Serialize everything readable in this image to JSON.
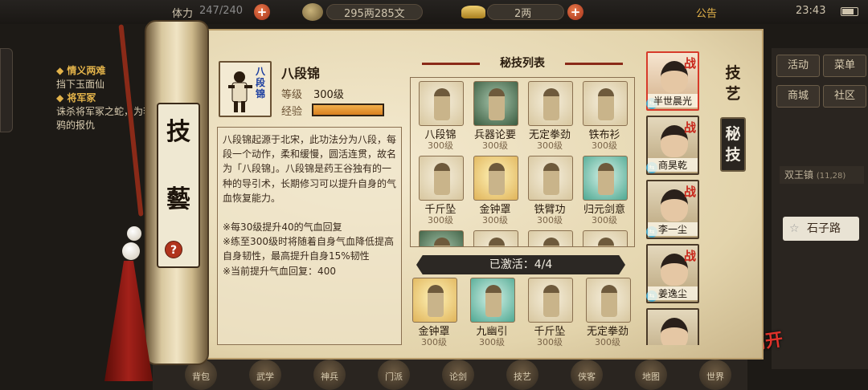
{
  "topbar": {
    "stamina_label": "体力",
    "stamina_value": "247/240",
    "money": "295两285文",
    "gold": "2两",
    "notice": "公告",
    "time": "23:43"
  },
  "quests": [
    {
      "title": "◆ 情义两难",
      "desc": "挡下玉面仙"
    },
    {
      "title": "◆ 将军冢",
      "desc": "诛杀将军冢之蛇，为李鸦的报仇"
    }
  ],
  "right_panel": {
    "buttons": [
      "活动",
      "菜单",
      "商城",
      "社区"
    ],
    "location": "双王镇",
    "location_coords": "(11,28)",
    "road": "石子路",
    "leave": "离开"
  },
  "dock": [
    "背包",
    "武学",
    "神兵",
    "门派",
    "论剑",
    "技艺",
    "侠客",
    "地图",
    "世界"
  ],
  "scroll": {
    "title_chars": [
      "技",
      "藝"
    ],
    "help": "?"
  },
  "skill": {
    "name": "八段锦",
    "portrait_text": "八段锦",
    "level_label": "等级",
    "level_value": "300级",
    "exp_label": "经验",
    "exp_fraction": 1.0,
    "description": "八段锦起源于北宋，此功法分为八段，每段一个动作，柔和缓慢，圆活连贯，故名为「八段锦」。八段锦是药王谷独有的一种的导引术，长期修习可以提升自身的气血恢复能力。",
    "notes": [
      "※每30级提升40的气血回复",
      "※练至300级时将随着自身气血降低提高自身韧性，最高提升自身15%韧性",
      "※当前提升气血回复：400"
    ]
  },
  "list": {
    "header": "秘技列表",
    "skills": [
      {
        "name": "八段锦",
        "level": "300级",
        "style": "plain"
      },
      {
        "name": "兵器论要",
        "level": "300级",
        "style": "book"
      },
      {
        "name": "无定拳劲",
        "level": "300级",
        "style": "plain"
      },
      {
        "name": "铁布衫",
        "level": "300级",
        "style": "plain"
      },
      {
        "name": "千斤坠",
        "level": "300级",
        "style": "plain"
      },
      {
        "name": "金钟罩",
        "level": "300级",
        "style": "gold"
      },
      {
        "name": "铁臂功",
        "level": "300级",
        "style": "plain"
      },
      {
        "name": "归元剑意",
        "level": "300级",
        "style": "teal"
      }
    ],
    "activated_label": "已激活：4/4",
    "activated": [
      {
        "name": "金钟罩",
        "level": "300级",
        "style": "gold"
      },
      {
        "name": "九幽引",
        "level": "300级",
        "style": "teal"
      },
      {
        "name": "千斤坠",
        "level": "300级",
        "style": "plain"
      },
      {
        "name": "无定拳劲",
        "level": "300级",
        "style": "plain"
      }
    ]
  },
  "heroes": [
    {
      "name": "半世晨光",
      "badge": "战",
      "selected": true
    },
    {
      "name": "商昊乾",
      "badge": "战",
      "selected": false
    },
    {
      "name": "李一尘",
      "badge": "战",
      "selected": false
    },
    {
      "name": "姜逸尘",
      "badge": "战",
      "selected": false
    },
    {
      "name": "",
      "badge": "",
      "selected": false
    }
  ],
  "tabs": {
    "craft": "技艺",
    "secret": "秘技"
  }
}
